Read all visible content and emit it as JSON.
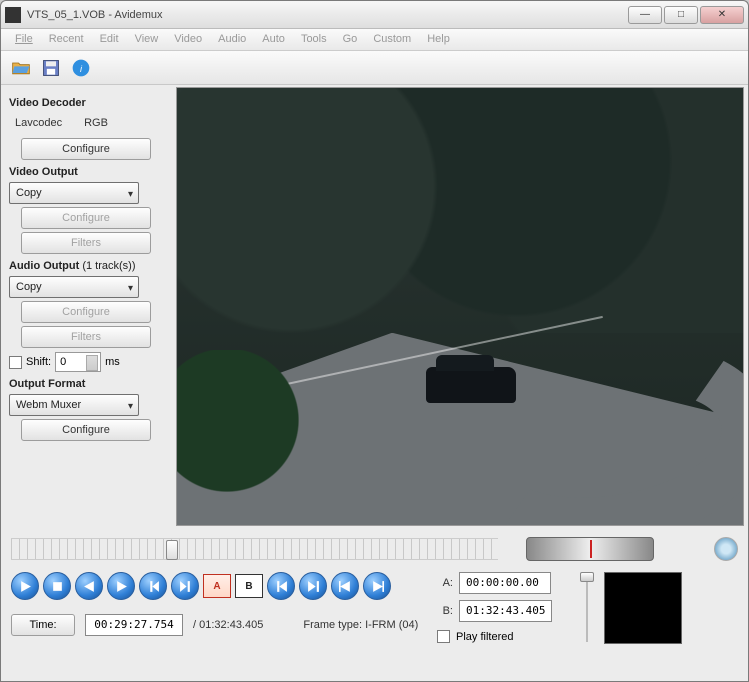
{
  "window": {
    "title": "VTS_05_1.VOB - Avidemux"
  },
  "menu": {
    "file": "File",
    "recent": "Recent",
    "edit": "Edit",
    "view": "View",
    "video": "Video",
    "audio": "Audio",
    "auto": "Auto",
    "tools": "Tools",
    "go": "Go",
    "custom": "Custom",
    "help": "Help"
  },
  "sidebar": {
    "video_decoder_title": "Video Decoder",
    "decoder_name": "Lavcodec",
    "decoder_mode": "RGB",
    "configure": "Configure",
    "video_output_title": "Video Output",
    "video_output_value": "Copy",
    "filters": "Filters",
    "audio_output_title": "Audio Output",
    "audio_output_sub": "(1 track(s))",
    "audio_output_value": "Copy",
    "shift_label": "Shift:",
    "shift_value": "0",
    "shift_unit": "ms",
    "output_format_title": "Output Format",
    "output_format_value": "Webm Muxer"
  },
  "markers": {
    "a_label": "A:",
    "a_value": "00:00:00.00",
    "b_label": "B:",
    "b_value": "01:32:43.405",
    "play_filtered": "Play filtered"
  },
  "time": {
    "button": "Time:",
    "current": "00:29:27.754",
    "total": "/ 01:32:43.405",
    "frame_label": "Frame type:",
    "frame_value": "I-FRM (04)"
  }
}
